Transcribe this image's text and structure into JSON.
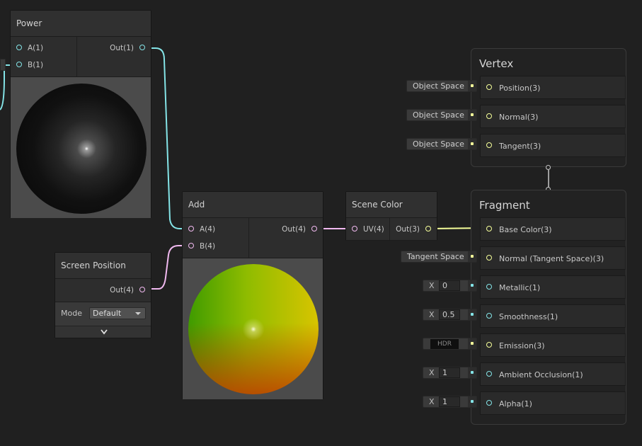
{
  "colors": {
    "vector1": "#84e4e7",
    "vector4": "#f1b9f0",
    "vector3": "#f6ff9a"
  },
  "power": {
    "title": "Power",
    "input_a": "A(1)",
    "input_b": "B(1)",
    "output": "Out(1)"
  },
  "add": {
    "title": "Add",
    "input_a": "A(4)",
    "input_b": "B(4)",
    "output": "Out(4)"
  },
  "screen_position": {
    "title": "Screen Position",
    "output": "Out(4)",
    "mode_label": "Mode",
    "mode_value": "Default"
  },
  "scene_color": {
    "title": "Scene Color",
    "input": "UV(4)",
    "output": "Out(3)"
  },
  "vertex": {
    "title": "Vertex",
    "slots": [
      {
        "label": "Position(3)",
        "default": "Object Space"
      },
      {
        "label": "Normal(3)",
        "default": "Object Space"
      },
      {
        "label": "Tangent(3)",
        "default": "Object Space"
      }
    ]
  },
  "fragment": {
    "title": "Fragment",
    "slots": [
      {
        "label": "Base Color(3)"
      },
      {
        "label": "Normal (Tangent Space)(3)",
        "default": "Tangent Space"
      },
      {
        "label": "Metallic(1)",
        "axis": "X",
        "value": "0"
      },
      {
        "label": "Smoothness(1)",
        "axis": "X",
        "value": "0.5"
      },
      {
        "label": "Emission(3)",
        "badge": "HDR"
      },
      {
        "label": "Ambient Occlusion(1)",
        "axis": "X",
        "value": "1"
      },
      {
        "label": "Alpha(1)",
        "axis": "X",
        "value": "1"
      }
    ]
  }
}
